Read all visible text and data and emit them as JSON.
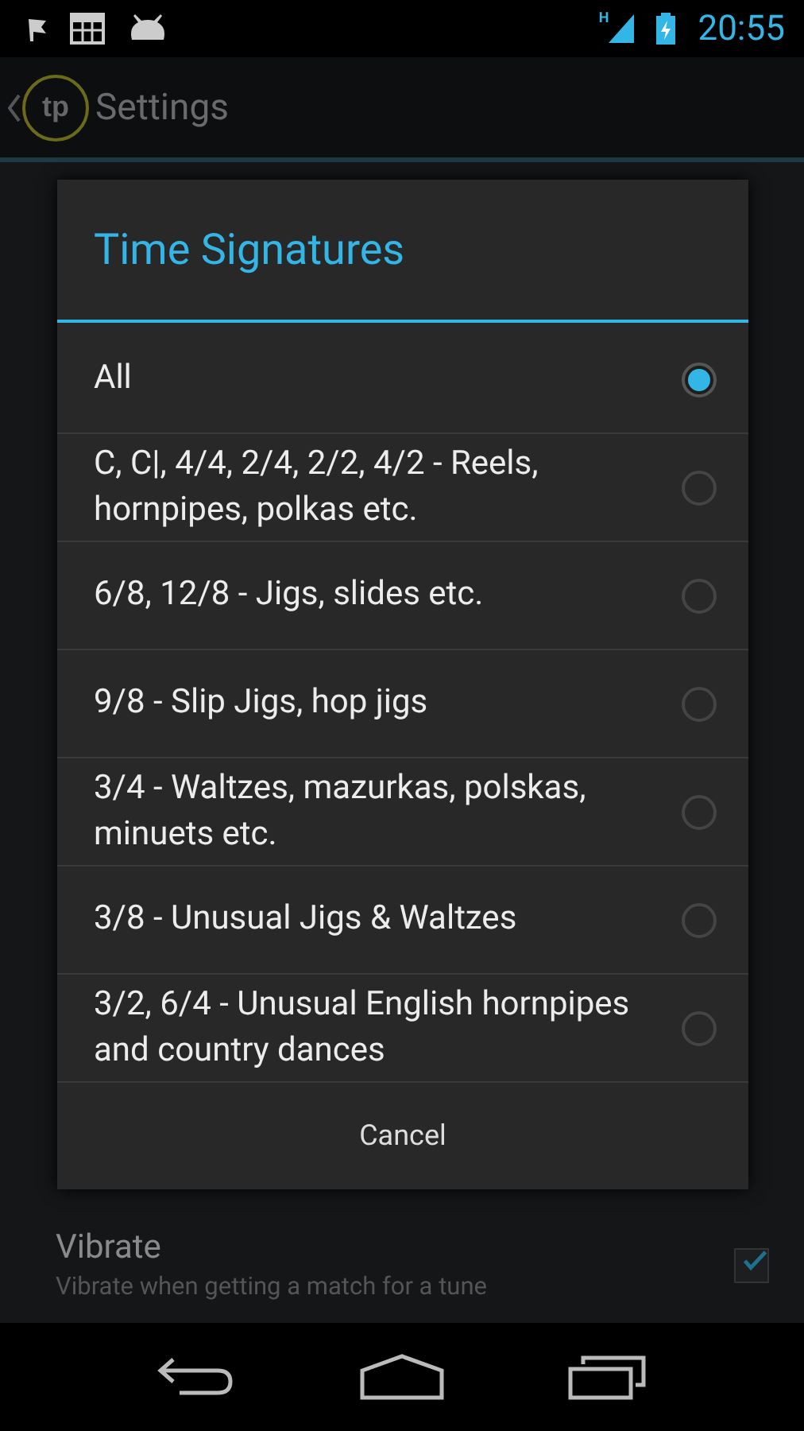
{
  "status_bar": {
    "network": "H",
    "time": "20:55"
  },
  "action_bar": {
    "logo": "tp",
    "title": "Settings"
  },
  "preferences": [
    {
      "title": "Vibrate",
      "summary": "Vibrate when getting a match for a tune",
      "checked": true
    }
  ],
  "dialog": {
    "title": "Time Signatures",
    "options": [
      {
        "label": "All",
        "selected": true
      },
      {
        "label": "C, C|, 4/4, 2/4, 2/2, 4/2 - Reels, hornpipes, polkas etc.",
        "selected": false
      },
      {
        "label": "6/8, 12/8 - Jigs, slides etc.",
        "selected": false
      },
      {
        "label": "9/8 - Slip Jigs, hop jigs",
        "selected": false
      },
      {
        "label": "3/4 - Waltzes, mazurkas, polskas, minuets etc.",
        "selected": false
      },
      {
        "label": "3/8 - Unusual Jigs & Waltzes",
        "selected": false
      },
      {
        "label": "3/2, 6/4 - Unusual English hornpipes and country dances",
        "selected": false
      }
    ],
    "cancel": "Cancel"
  }
}
